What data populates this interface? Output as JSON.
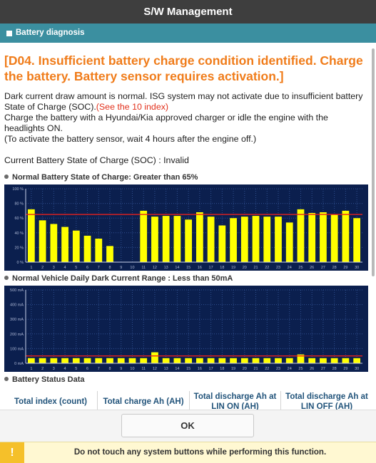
{
  "window": {
    "title": "S/W Management"
  },
  "section": {
    "title": "Battery diagnosis"
  },
  "diagnosis": {
    "title": "[D04. Insufficient battery charge condition identified. Charge the battery. Battery sensor requires activation.]",
    "line1": "Dark current draw amount is normal. ISG system may not activate due to insufficient battery State of Charge (SOC).",
    "line1_link": "(See the 10 index)",
    "line2": "Charge the battery with a Hyundai/Kia approved charger or idle the engine with the headlights ON.",
    "line3": "(To activate the battery sensor, wait 4 hours after the engine off.)",
    "soc_line": "Current Battery State of Charge (SOC) : Invalid"
  },
  "chart_data": [
    {
      "type": "bar",
      "title": "Normal Battery State of Charge: Greater than 65%",
      "categories": [
        "1",
        "2",
        "3",
        "4",
        "5",
        "6",
        "7",
        "8",
        "9",
        "10",
        "11",
        "12",
        "13",
        "14",
        "15",
        "16",
        "17",
        "18",
        "19",
        "20",
        "21",
        "22",
        "23",
        "24",
        "25",
        "26",
        "27",
        "28",
        "29",
        "30"
      ],
      "values": [
        72,
        57,
        52,
        48,
        43,
        36,
        32,
        22,
        0,
        0,
        70,
        62,
        63,
        63,
        58,
        68,
        62,
        50,
        60,
        62,
        63,
        62,
        62,
        54,
        72,
        67,
        68,
        65,
        70,
        60
      ],
      "yticks": [
        "0 %",
        "20 %",
        "40 %",
        "60 %",
        "80 %",
        "100 %"
      ],
      "ylim": [
        0,
        100
      ],
      "threshold": 65,
      "bar_color": "#ffff00",
      "background": "#0b1f4e",
      "threshold_color": "#e8201e",
      "grid": true
    },
    {
      "type": "bar",
      "title": "Normal Vehicle Daily Dark Current Range : Less than 50mA",
      "categories": [
        "1",
        "2",
        "3",
        "4",
        "5",
        "6",
        "7",
        "8",
        "9",
        "10",
        "11",
        "12",
        "13",
        "14",
        "15",
        "16",
        "17",
        "18",
        "19",
        "20",
        "21",
        "22",
        "23",
        "24",
        "25",
        "26",
        "27",
        "28",
        "29",
        "30"
      ],
      "values": [
        35,
        35,
        35,
        35,
        35,
        35,
        35,
        35,
        35,
        35,
        35,
        75,
        35,
        35,
        35,
        35,
        35,
        35,
        35,
        35,
        35,
        35,
        35,
        35,
        60,
        35,
        35,
        35,
        35,
        35
      ],
      "yticks": [
        "0 mA",
        "100 mA",
        "200 mA",
        "300 mA",
        "400 mA",
        "500 mA"
      ],
      "ylim": [
        0,
        500
      ],
      "threshold": 50,
      "bar_color": "#ffff00",
      "background": "#0b1f4e",
      "threshold_color": "#e8201e",
      "grid": true
    }
  ],
  "status_table": {
    "title": "Battery Status Data",
    "columns": [
      "Total index (count)",
      "Total charge Ah (AH)",
      "Total discharge Ah at LIN ON (AH)",
      "Total discharge Ah at LIN OFF (AH)"
    ]
  },
  "buttons": {
    "ok": "OK"
  },
  "warning": {
    "icon": "!",
    "text": "Do not touch any system buttons while performing this function."
  }
}
